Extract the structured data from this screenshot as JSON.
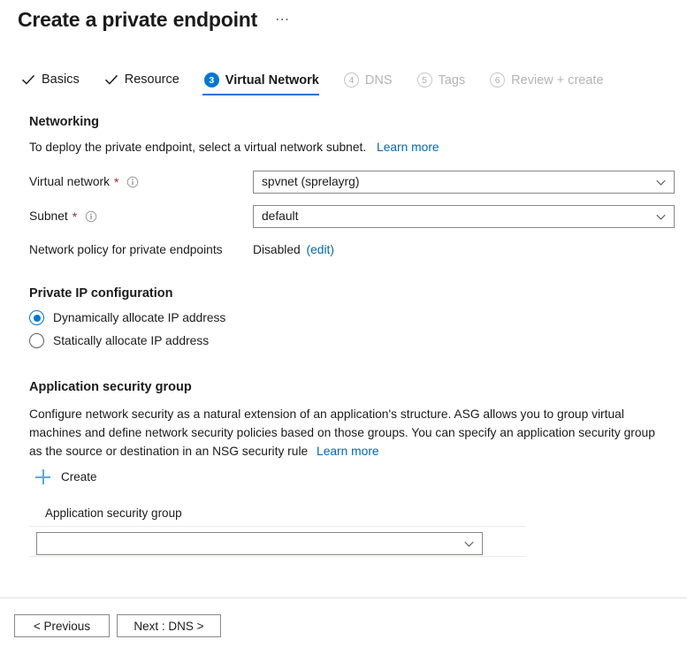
{
  "header": {
    "title": "Create a private endpoint",
    "more_label": "⋯"
  },
  "wizard": {
    "tabs": [
      {
        "label": "Basics",
        "state": "done",
        "marker": "check"
      },
      {
        "label": "Resource",
        "state": "done",
        "marker": "check"
      },
      {
        "label": "Virtual Network",
        "state": "active",
        "marker": "3"
      },
      {
        "label": "DNS",
        "state": "disabled",
        "marker": "4"
      },
      {
        "label": "Tags",
        "state": "disabled",
        "marker": "5"
      },
      {
        "label": "Review + create",
        "state": "disabled",
        "marker": "6"
      }
    ]
  },
  "networking": {
    "heading": "Networking",
    "description": "To deploy the private endpoint, select a virtual network subnet.",
    "learn_more": "Learn more",
    "virtual_network": {
      "label": "Virtual network",
      "required_mark": "*",
      "value": "spvnet (sprelayrg)"
    },
    "subnet": {
      "label": "Subnet",
      "required_mark": "*",
      "value": "default"
    },
    "network_policy": {
      "label": "Network policy for private endpoints",
      "value": "Disabled",
      "edit_link": "(edit)"
    }
  },
  "private_ip": {
    "heading": "Private IP configuration",
    "options": [
      {
        "label": "Dynamically allocate IP address",
        "selected": true
      },
      {
        "label": "Statically allocate IP address",
        "selected": false
      }
    ]
  },
  "asg": {
    "heading": "Application security group",
    "description": "Configure network security as a natural extension of an application's structure. ASG allows you to group virtual machines and define network security policies based on those groups. You can specify an application security group as the source or destination in an NSG security rule",
    "learn_more": "Learn more",
    "create_label": "Create",
    "grid_header": "Application security group",
    "selected_value": ""
  },
  "footer": {
    "previous_label": "< Previous",
    "next_label": "Next : DNS >"
  },
  "colors": {
    "accent": "#0078d4",
    "link": "#0067b8",
    "required": "#a4262c",
    "plus": "#5aa9e6",
    "border": "#8a8886"
  }
}
